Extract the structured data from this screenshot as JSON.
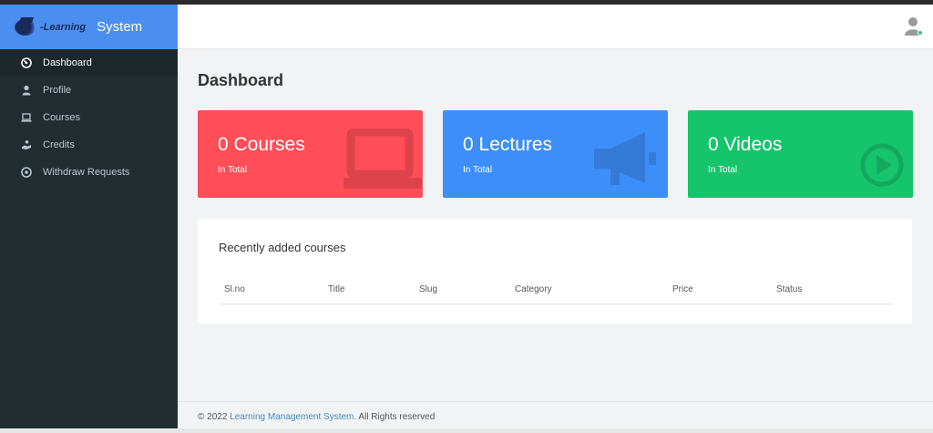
{
  "brand": {
    "logo_text": "-Learning",
    "title": "System"
  },
  "sidebar": {
    "items": [
      {
        "label": "Dashboard",
        "icon": "dashboard-icon"
      },
      {
        "label": "Profile",
        "icon": "user-icon"
      },
      {
        "label": "Courses",
        "icon": "laptop-icon"
      },
      {
        "label": "Credits",
        "icon": "credits-icon"
      },
      {
        "label": "Withdraw Requests",
        "icon": "withdraw-icon"
      }
    ]
  },
  "main": {
    "title": "Dashboard",
    "cards": [
      {
        "value": "0 Courses",
        "sub": "In Total",
        "color": "#ff4e57",
        "icon": "laptop-icon"
      },
      {
        "value": "0 Lectures",
        "sub": "In Total",
        "color": "#3d8ef8",
        "icon": "megaphone-icon"
      },
      {
        "value": "0 Videos",
        "sub": "In Total",
        "color": "#16c46c",
        "icon": "play-circle-icon"
      }
    ],
    "recent": {
      "title": "Recently added courses",
      "columns": [
        "Sl.no",
        "Title",
        "Slug",
        "Category",
        "Price",
        "Status"
      ]
    }
  },
  "footer": {
    "prefix": "© 2022 ",
    "link": "Learning Management System.",
    "suffix": " All Rights reserved"
  },
  "colors": {
    "sidebar": "#222d32",
    "brand": "#4a8ff0",
    "status_online": "#2ecc71"
  }
}
